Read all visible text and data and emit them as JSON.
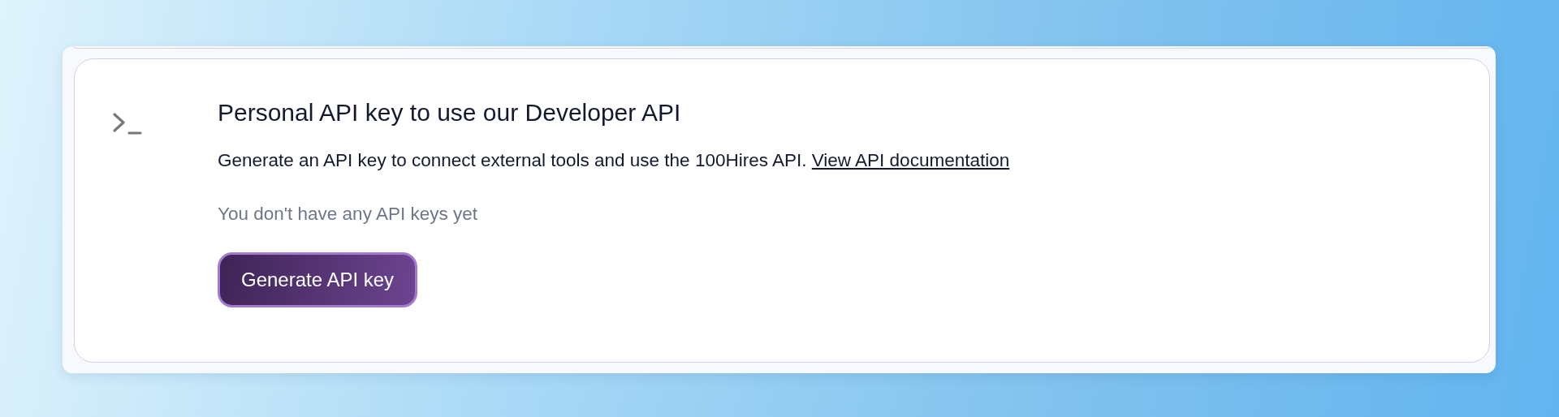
{
  "section": {
    "title": "Personal API key to use our Developer API",
    "description": "Generate an API key to connect external tools and use the 100Hires API.",
    "link": "View API documentation",
    "empty_message": "You don't have any API keys yet",
    "button": "Generate API key"
  }
}
